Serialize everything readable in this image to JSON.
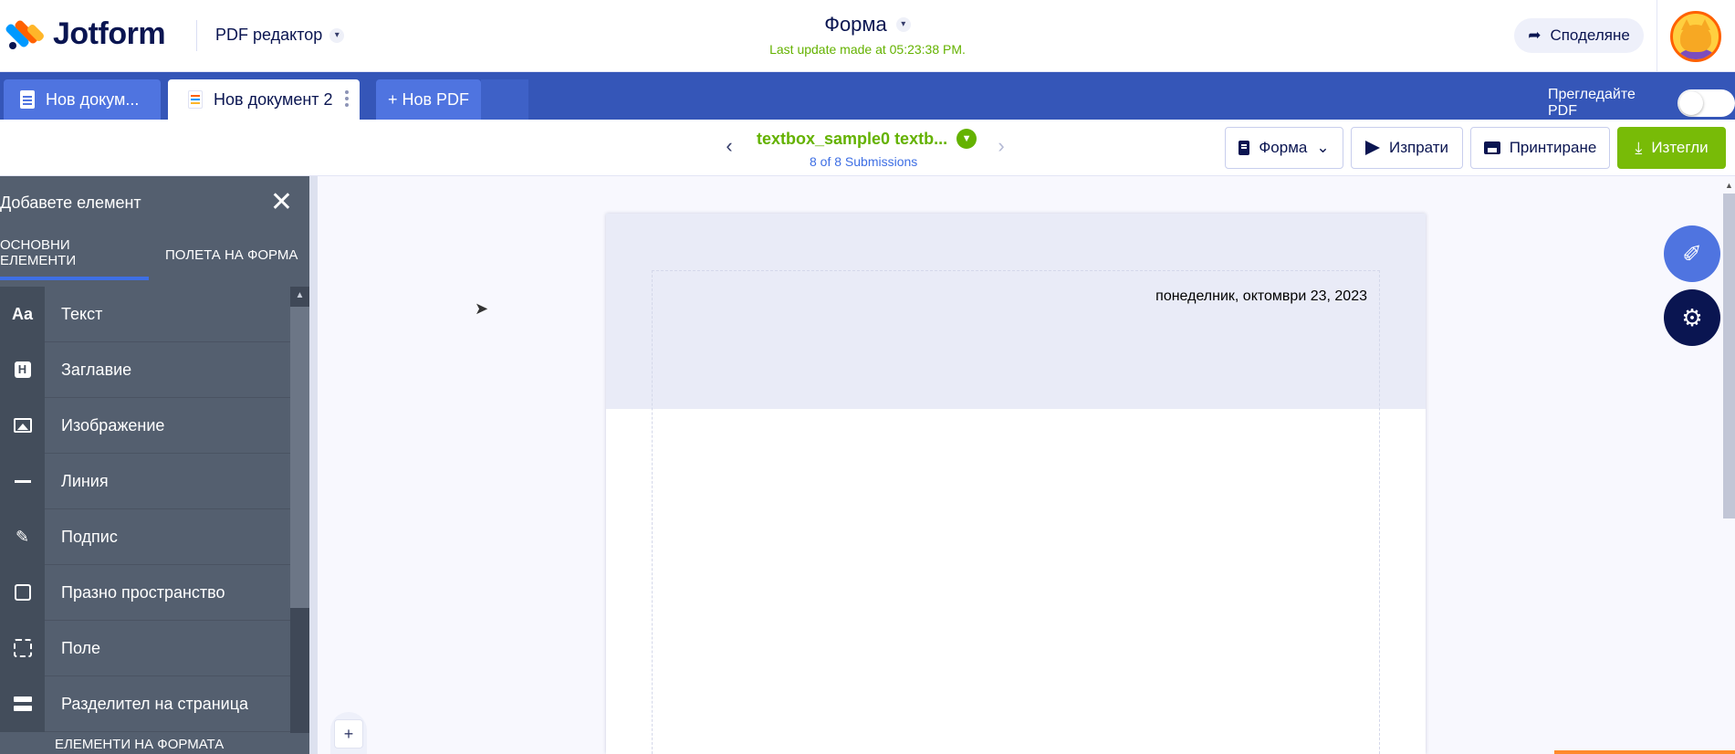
{
  "header": {
    "brand": "Jotform",
    "product": "PDF редактор",
    "form_title": "Форма",
    "last_update": "Last update made at 05:23:38 PM.",
    "share_label": "Споделяне"
  },
  "tabs": {
    "items": [
      {
        "label": "Нов докум..."
      },
      {
        "label": "Нов документ 2"
      }
    ],
    "new_label": "+ Нов PDF",
    "preview_label": "Прегледайте PDF",
    "preview_enabled": false
  },
  "submission": {
    "title": "textbox_sample0 textb...",
    "count": "8 of 8 Submissions"
  },
  "toolbar": {
    "form_label": "Форма",
    "send_label": "Изпрати",
    "print_label": "Принтиране",
    "download_label": "Изтегли"
  },
  "panel": {
    "title": "Добавете елемент",
    "tab_basic": "ОСНОВНИ ЕЛЕМЕНТИ",
    "tab_fields": "ПОЛЕТА НА ФОРМА",
    "items": [
      {
        "label": "Текст",
        "icon": "text-icon",
        "glyph": "Aa"
      },
      {
        "label": "Заглавие",
        "icon": "heading-icon",
        "glyph": "H"
      },
      {
        "label": "Изображение",
        "icon": "image-icon"
      },
      {
        "label": "Линия",
        "icon": "line-icon"
      },
      {
        "label": "Подпис",
        "icon": "signature-icon",
        "glyph": "✎"
      },
      {
        "label": "Празно пространство",
        "icon": "spacer-icon"
      },
      {
        "label": "Поле",
        "icon": "field-icon"
      },
      {
        "label": "Разделител на страница",
        "icon": "page-break-icon"
      }
    ],
    "footer": "ЕЛЕМЕНТИ НА ФОРМАТА"
  },
  "document": {
    "date": "понеделник, октомври 23, 2023"
  },
  "colors": {
    "accent": "#3e6fe4",
    "tabs_bar": "#3556b8",
    "success": "#78bb07",
    "panel": "#545f6f"
  }
}
